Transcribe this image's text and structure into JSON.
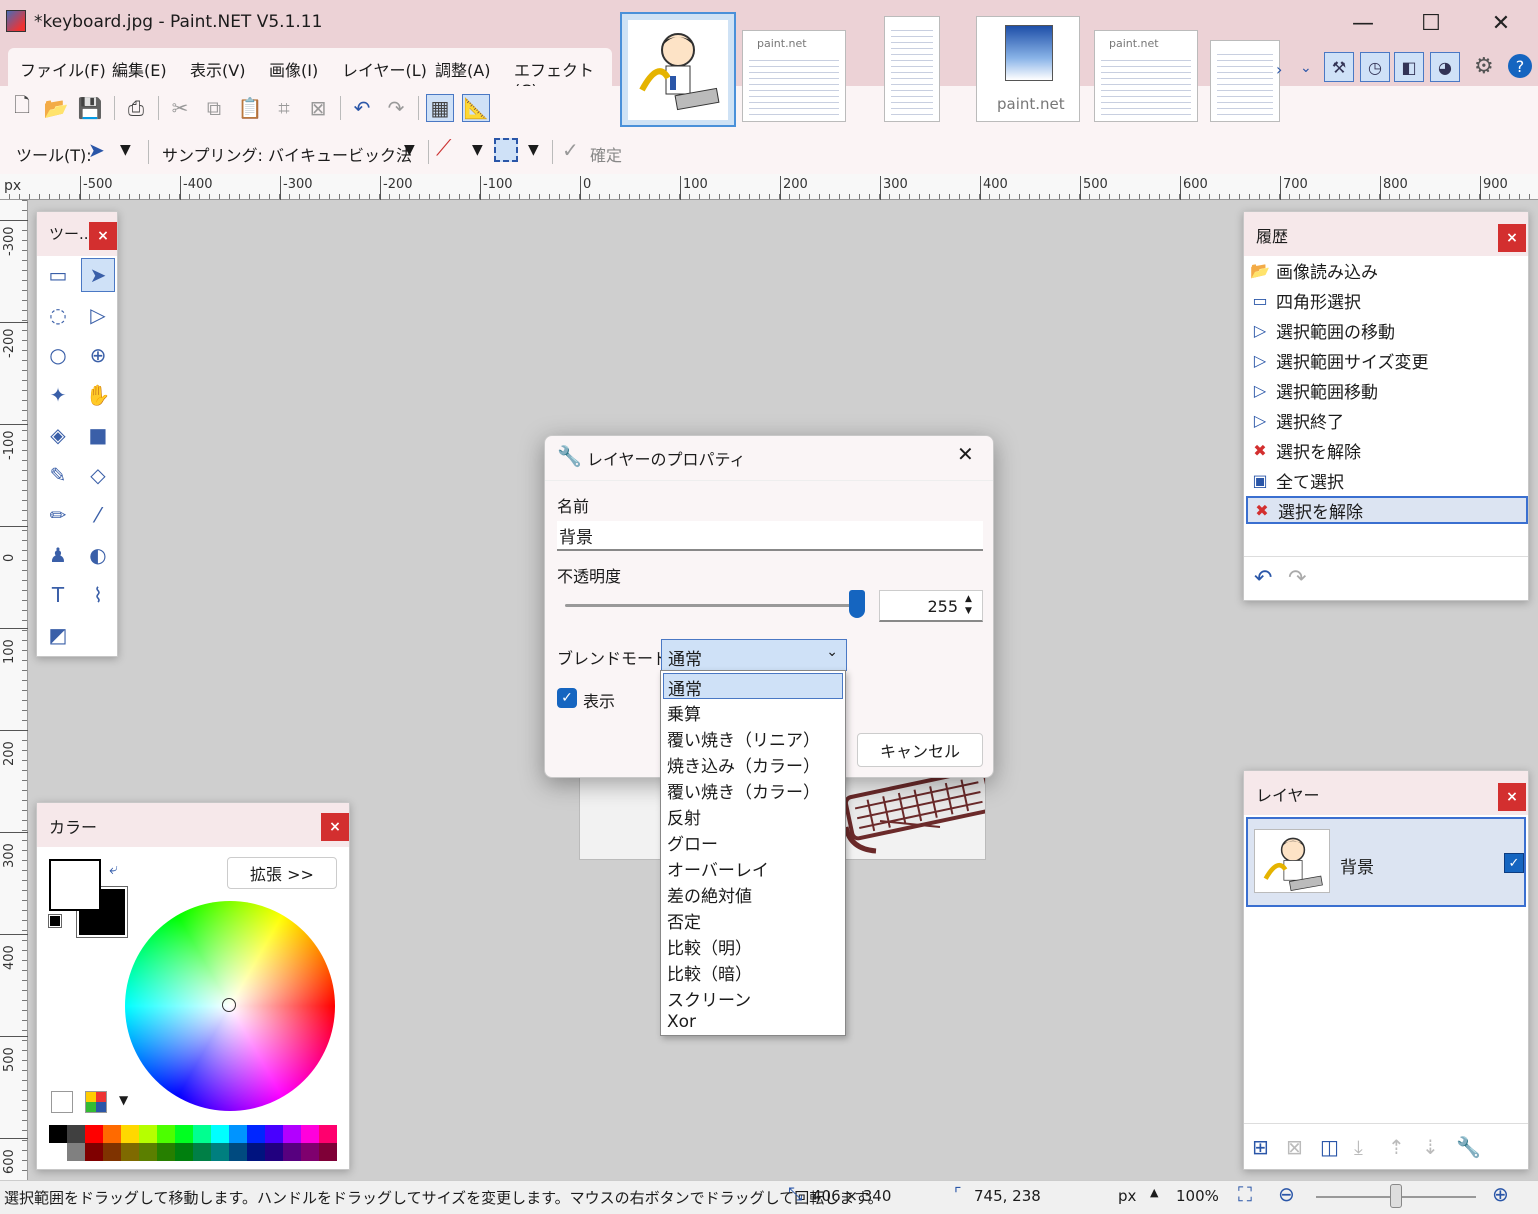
{
  "window": {
    "title": "*keyboard.jpg - Paint.NET V5.1.11",
    "minimize_glyph": "—",
    "maximize_glyph": "☐",
    "close_glyph": "✕"
  },
  "menu": [
    "ファイル(F)",
    "編集(E)",
    "表示(V)",
    "画像(I)",
    "レイヤー(L)",
    "調整(A)",
    "エフェクト(C)"
  ],
  "thumbnails": {
    "paint_net_label": "paint.net",
    "doc_label": "paint.net"
  },
  "options_bar": {
    "tool_label": "ツール(T):",
    "sampling_label": "サンプリング:",
    "sampling_value": "バイキュービック法",
    "confirm_label": "確定"
  },
  "ruler": {
    "unit": "px",
    "top_labels": [
      "-500",
      "-400",
      "-300",
      "-200",
      "-100",
      "0",
      "100",
      "200",
      "300",
      "400",
      "500",
      "600",
      "700",
      "800",
      "900"
    ],
    "left_labels": [
      "-300",
      "-200",
      "-100",
      "0",
      "100",
      "200",
      "300",
      "400",
      "500",
      "600"
    ]
  },
  "tools_panel": {
    "title": "ツー...",
    "close": "×",
    "tools": [
      {
        "name": "rectangle-select-icon",
        "glyph": "▭"
      },
      {
        "name": "move-selection-icon",
        "glyph": "➤"
      },
      {
        "name": "lasso-select-icon",
        "glyph": "◌"
      },
      {
        "name": "move-selected-icon",
        "glyph": "▷"
      },
      {
        "name": "ellipse-select-icon",
        "glyph": "○"
      },
      {
        "name": "zoom-icon",
        "glyph": "⊕"
      },
      {
        "name": "magic-wand-icon",
        "glyph": "✦"
      },
      {
        "name": "pan-icon",
        "glyph": "✋"
      },
      {
        "name": "paint-bucket-icon",
        "glyph": "◈"
      },
      {
        "name": "gradient-icon",
        "glyph": "■"
      },
      {
        "name": "paintbrush-icon",
        "glyph": "✎"
      },
      {
        "name": "eraser-icon",
        "glyph": "◇"
      },
      {
        "name": "pencil-icon",
        "glyph": "✏"
      },
      {
        "name": "color-picker-icon",
        "glyph": "⁄"
      },
      {
        "name": "clone-stamp-icon",
        "glyph": "♟"
      },
      {
        "name": "recolor-icon",
        "glyph": "◐"
      },
      {
        "name": "text-icon",
        "glyph": "T"
      },
      {
        "name": "line-curve-icon",
        "glyph": "⌇"
      },
      {
        "name": "shapes-icon",
        "glyph": "◩"
      }
    ]
  },
  "history_panel": {
    "title": "履歴",
    "close": "×",
    "items": [
      {
        "label": "画像読み込み",
        "icon": "open-folder-icon",
        "glyph": "📂"
      },
      {
        "label": "四角形選択",
        "icon": "rectangle-select-icon",
        "glyph": "▭"
      },
      {
        "label": "選択範囲の移動",
        "icon": "move-selection-icon",
        "glyph": "▷"
      },
      {
        "label": "選択範囲サイズ変更",
        "icon": "move-selection-icon",
        "glyph": "▷"
      },
      {
        "label": "選択範囲移動",
        "icon": "move-selection-icon",
        "glyph": "▷"
      },
      {
        "label": "選択終了",
        "icon": "move-selection-icon",
        "glyph": "▷"
      },
      {
        "label": "選択を解除",
        "icon": "deselect-icon",
        "glyph": "✖"
      },
      {
        "label": "全て選択",
        "icon": "select-all-icon",
        "glyph": "▣"
      },
      {
        "label": "選択を解除",
        "icon": "deselect-icon",
        "glyph": "✖"
      }
    ],
    "undo_glyph": "↶",
    "redo_glyph": "↷"
  },
  "layers_panel": {
    "title": "レイヤー",
    "close": "×",
    "layer_name": "背景",
    "check": "✓"
  },
  "colors_panel": {
    "title": "カラー",
    "close": "×",
    "expand_label": "拡張 >>",
    "palette_top": [
      "#000000",
      "#404040",
      "#ff0000",
      "#ff6a00",
      "#ffd800",
      "#b6ff00",
      "#4cff00",
      "#00ff21",
      "#00ff90",
      "#00ffff",
      "#0094ff",
      "#0026ff",
      "#4800ff",
      "#b200ff",
      "#ff00dc",
      "#ff006e"
    ],
    "palette_bottom": [
      "#ffffff",
      "#808080",
      "#7f0000",
      "#7f3300",
      "#7f6a00",
      "#5b7f00",
      "#267f00",
      "#007f0e",
      "#007f46",
      "#007f7f",
      "#004a7f",
      "#00137f",
      "#21007f",
      "#57007f",
      "#7f006e",
      "#7f0037"
    ]
  },
  "dialog": {
    "title": "レイヤーのプロパティ",
    "close": "✕",
    "name_label": "名前",
    "name_value": "背景",
    "opacity_label": "不透明度",
    "opacity_value": "255",
    "opacity_fraction": 1.0,
    "blend_label": "ブレンドモード:",
    "blend_value": "通常",
    "visible_label": "表示",
    "cancel_label": "キャンセル"
  },
  "blend_modes": [
    "通常",
    "乗算",
    "覆い焼き（リニア）",
    "焼き込み（カラー）",
    "覆い焼き（カラー）",
    "反射",
    "グロー",
    "オーバーレイ",
    "差の絶対値",
    "否定",
    "比較（明）",
    "比較（暗）",
    "スクリーン",
    "Xor"
  ],
  "status": {
    "hint": "選択範囲をドラッグして移動します。ハンドルをドラッグしてサイズを変更します。マウスの右ボタンでドラッグして回転します。",
    "selection_size": "406 × 340",
    "cursor_pos": "745, 238",
    "unit": "px",
    "zoom": "100%"
  },
  "colors": {
    "accent": "#1565c0",
    "selection_bg": "#cfe1f7",
    "close_red": "#d32f2f",
    "header_pink": "#ecd2d6"
  }
}
